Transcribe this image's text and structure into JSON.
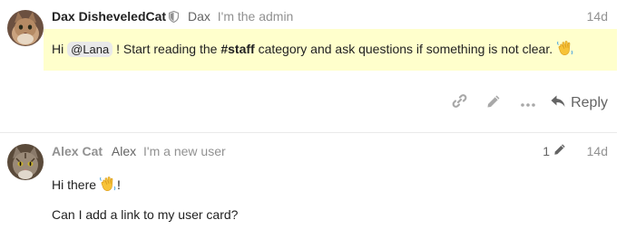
{
  "posts": [
    {
      "full_name": "Dax DisheveledCat",
      "username": "Dax",
      "user_title": "I'm the admin",
      "date": "14d",
      "body": {
        "text_hi": "Hi",
        "mention": "@Lana",
        "text_mid": "! Start reading the",
        "hashtag": "#staff",
        "text_end": "category and ask questions if something is not clear."
      },
      "actions": {
        "reply_label": "Reply"
      },
      "highlight_color": "#ffffcc"
    },
    {
      "full_name": "Alex Cat",
      "username": "Alex",
      "user_title": "I'm a new user",
      "edit_count": "1",
      "date": "14d",
      "body": {
        "line1": "Hi there",
        "line1_end": "!",
        "line2": "Can I add a link to my user card?"
      }
    }
  ],
  "icons": {
    "admin_badge": "shield-icon",
    "link": "link-icon",
    "edit": "pencil-icon",
    "more": "ellipsis-icon",
    "reply": "reply-icon",
    "emoji": "waving-hand-icon"
  }
}
